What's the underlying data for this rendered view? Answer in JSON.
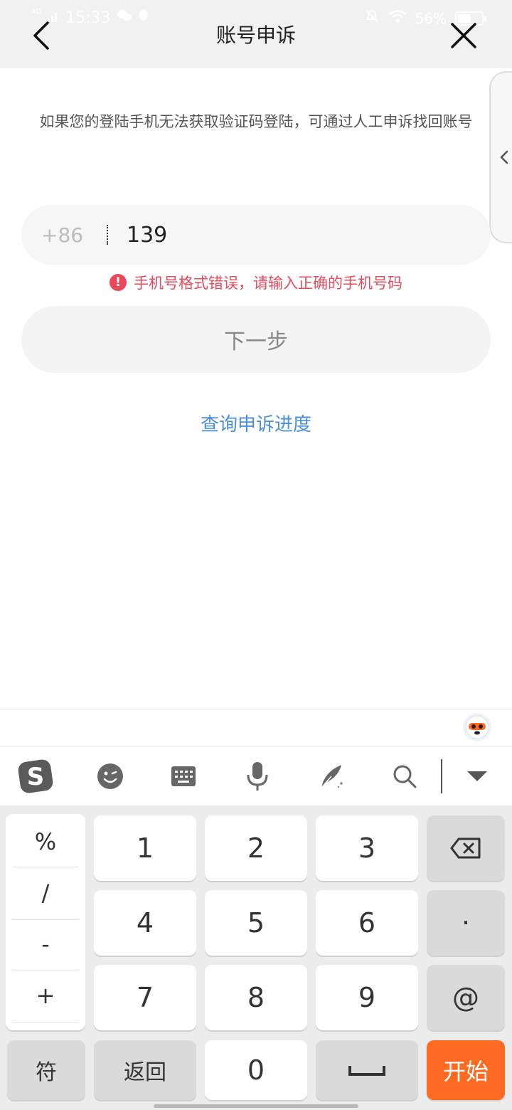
{
  "status_bar": {
    "network": "4G",
    "time": "15:33",
    "battery": "56%",
    "battery_level": 0.56
  },
  "header": {
    "title": "账号申诉",
    "back_icon": "chevron-left-icon",
    "close_icon": "close-icon"
  },
  "main": {
    "tip": "如果您的登陆手机无法获取验证码登陆，可通过人工申诉找回账号",
    "phone": {
      "country_code": "+86",
      "value": "139"
    },
    "error": "手机号格式错误，请输入正确的手机号码",
    "next_button": "下一步",
    "query_link": "查询申诉进度"
  },
  "colors": {
    "error": "#e84a5a",
    "link": "#4a90d9",
    "accent": "#ff6a23"
  },
  "keyboard": {
    "toolbar": [
      "sogou-logo-icon",
      "emoji-icon",
      "keyboard-icon",
      "mic-icon",
      "handwriting-icon",
      "search-icon",
      "collapse-icon"
    ],
    "symbols": [
      "%",
      "/",
      "-",
      "+"
    ],
    "digits": [
      "1",
      "2",
      "3",
      "4",
      "5",
      "6",
      "7",
      "8",
      "9",
      "0"
    ],
    "dot": "·",
    "at": "@",
    "sym_key": "符",
    "return_key": "返回",
    "start_key": "开始"
  }
}
